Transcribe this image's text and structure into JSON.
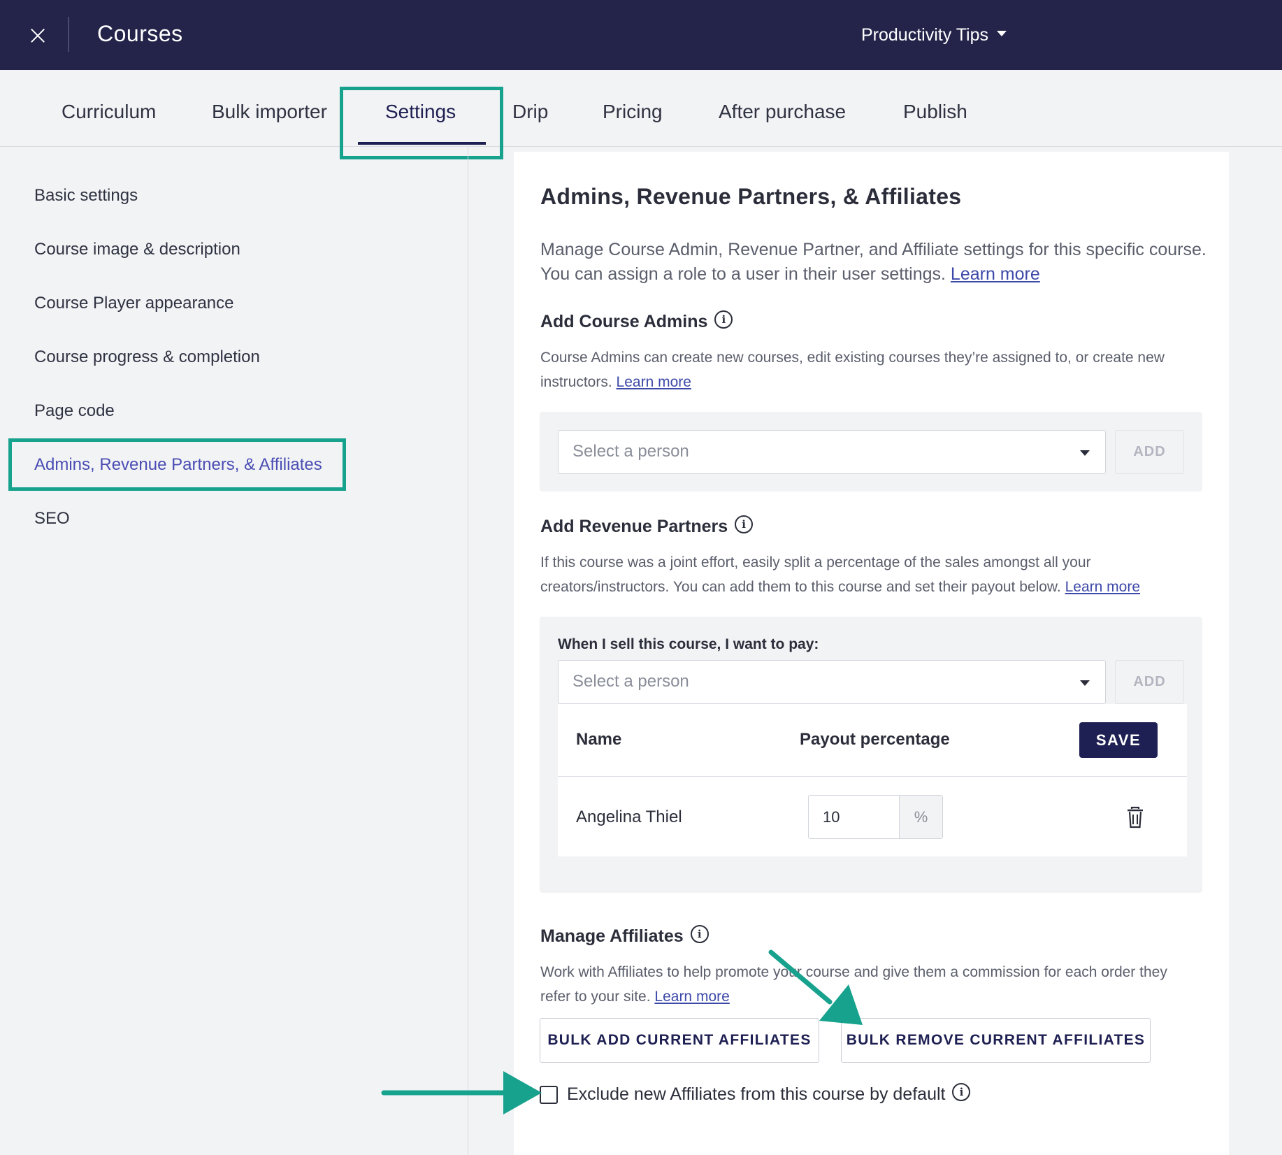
{
  "header": {
    "close_label": "×",
    "title": "Courses",
    "school_name": "Productivity Tips"
  },
  "tabs": [
    {
      "label": "Curriculum"
    },
    {
      "label": "Bulk importer"
    },
    {
      "label": "Settings",
      "active": true
    },
    {
      "label": "Drip"
    },
    {
      "label": "Pricing"
    },
    {
      "label": "After purchase"
    },
    {
      "label": "Publish"
    }
  ],
  "sidebar": {
    "items": [
      {
        "label": "Basic settings"
      },
      {
        "label": "Course image & description"
      },
      {
        "label": "Course Player appearance"
      },
      {
        "label": "Course progress & completion"
      },
      {
        "label": "Page code"
      },
      {
        "label": "Admins, Revenue Partners, & Affiliates",
        "active": true
      },
      {
        "label": "SEO"
      }
    ]
  },
  "main": {
    "title": "Admins, Revenue Partners, & Affiliates",
    "intro": "Manage Course Admin, Revenue Partner, and Affiliate settings for this specific course. You can assign a role to a user in their user settings.",
    "intro_link": "Learn more",
    "admins": {
      "heading": "Add Course Admins",
      "desc": "Course Admins can create new courses, edit existing courses they’re assigned to, or create new instructors.",
      "link": "Learn more",
      "select_placeholder": "Select a person",
      "add_label": "ADD"
    },
    "revenue": {
      "heading": "Add Revenue Partners",
      "desc": "If this course was a joint effort, easily split a percentage of the sales amongst all your creators/instructors. You can add them to this course and set their payout below.",
      "link": "Learn more",
      "field_label": "When I sell this course, I want to pay:",
      "select_placeholder": "Select a person",
      "add_label": "ADD",
      "columns": [
        "Name",
        "Payout percentage"
      ],
      "save_label": "SAVE",
      "rows": [
        {
          "name": "Angelina Thiel",
          "payout": "10",
          "suffix": "%"
        }
      ]
    },
    "affiliates": {
      "heading": "Manage Affiliates",
      "desc": "Work with Affiliates to help promote your course and give them a commission for each order they refer to your site.",
      "link": "Learn more",
      "bulk_add_label": "BULK ADD CURRENT AFFILIATES",
      "bulk_remove_label": "BULK REMOVE CURRENT AFFILIATES",
      "exclude_label": "Exclude new Affiliates from this course by default",
      "exclude_checked": false
    }
  },
  "colors": {
    "topbar": "#24244a",
    "accent": "#1e1f52",
    "highlight": "#17a28d",
    "link": "#3d49a8",
    "sidebar_active": "#4a4db3"
  },
  "icons": [
    "close-icon",
    "caret-down-icon",
    "info-icon",
    "trash-icon",
    "annotation-arrow"
  ]
}
